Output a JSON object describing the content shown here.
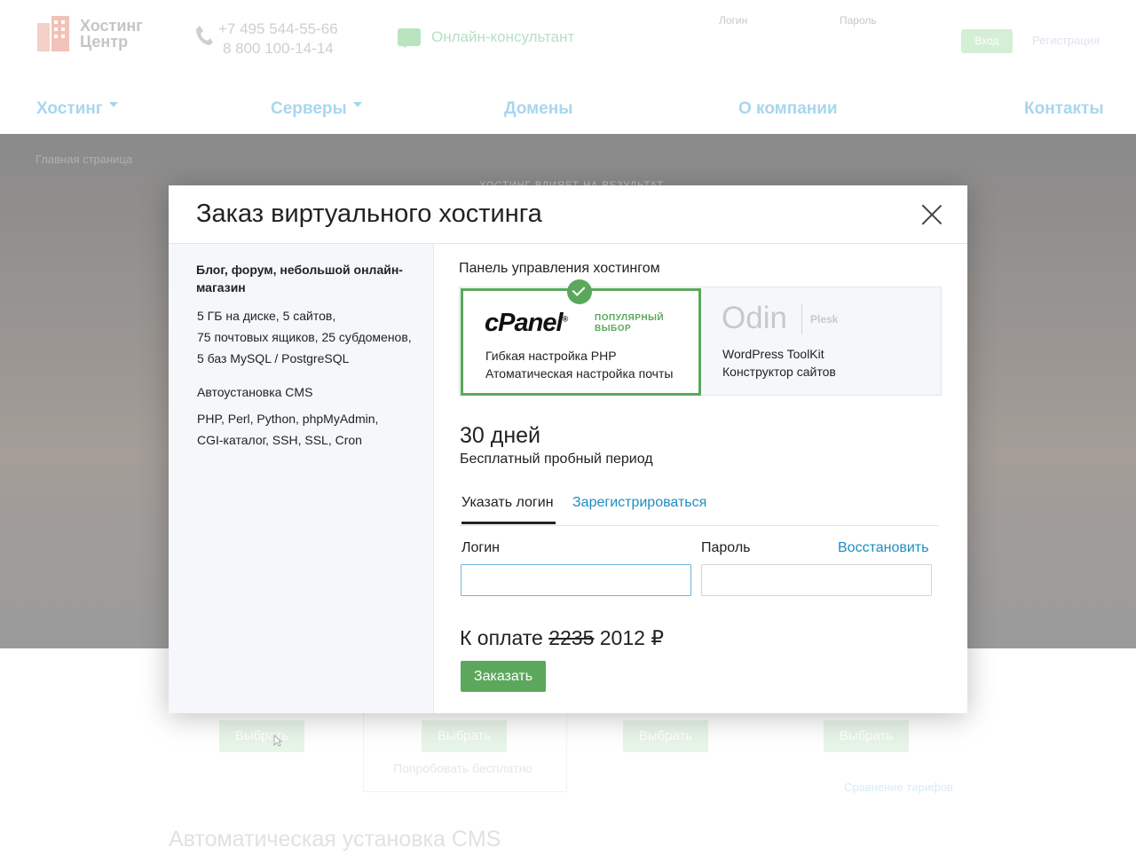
{
  "background": {
    "logo_text": [
      "Хостинг",
      "Центр"
    ],
    "phones": [
      "+7 495 544-55-66",
      "8 800 100-14-14"
    ],
    "consultant": "Онлайн-консультант",
    "login_label": "Логин",
    "password_label": "Пароль",
    "login_button": "Вход",
    "register_link": "Регистрация",
    "nav": [
      "Хостинг",
      "Серверы",
      "Домены",
      "О компании",
      "Контакты"
    ],
    "breadcrumb": "Главная страница",
    "hero_caption": "ХОСТИНГ ВЛИЯЕТ НА РЕЗУЛЬТАТ",
    "choose_button": "Выбрать",
    "try_free": "Попробовать бесплатно",
    "compare_tariffs": "Сравнение тарифов",
    "cms_heading": "Автоматическая установка CMS"
  },
  "modal": {
    "title": "Заказ виртуального хостинга",
    "plan": {
      "name": "Блог, форум, небольшой онлайн-магазин",
      "specs": [
        "5 ГБ на диске, 5 сайтов,",
        "75 почтовых ящиков, 25 субдоменов,",
        "5 баз MySQL / PostgreSQL"
      ],
      "cms": "Автоустановка CMS",
      "features": [
        "PHP, Perl, Python, phpMyAdmin,",
        "CGI-каталог, SSH, SSL, Cron"
      ]
    },
    "panel_label": "Панель управления хостингом",
    "cpanel": {
      "logo": "cPanel",
      "badge": [
        "ПОПУЛЯРНЫЙ",
        "ВЫБОР"
      ],
      "features": [
        "Гибкая настройка PHP",
        "Атоматическая настройка почты"
      ]
    },
    "plesk": {
      "logo": "Odin",
      "name": "Plesk",
      "features": [
        "WordPress ToolKit",
        "Конструктор сайтов"
      ]
    },
    "trial_days": "30 дней",
    "trial_label": "Бесплатный пробный период",
    "tabs": {
      "login": "Указать логин",
      "register": "Зарегистрироваться"
    },
    "login_label": "Логин",
    "password_label": "Пароль",
    "restore": "Восстановить",
    "login_value": "",
    "password_value": "",
    "pay_label": "К оплате",
    "old_price": "2235",
    "new_price": "2012",
    "currency": "₽",
    "order_button": "Заказать"
  },
  "colors": {
    "accent_green": "#5ba85c",
    "link_blue": "#1c8ec2"
  }
}
